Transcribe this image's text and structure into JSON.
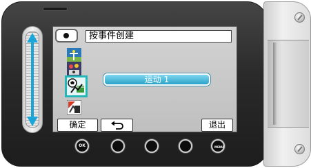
{
  "screen": {
    "title": "按事件创建",
    "selected_event": "运动 1",
    "buttons": {
      "confirm": "确定",
      "exit": "退出"
    }
  },
  "hardware": {
    "ok_label": "OK",
    "menu_label": "MENU"
  },
  "icons": [
    "menu-icon",
    "party-icon",
    "festival-icon",
    "sports-icon",
    "competition-icon",
    "back-arrow-icon",
    "slider-arrows-icon"
  ],
  "colors": {
    "selection_border": "#23b7b7",
    "selected_label_top": "#7fd8f0",
    "selected_label_bottom": "#2aa2c8"
  }
}
